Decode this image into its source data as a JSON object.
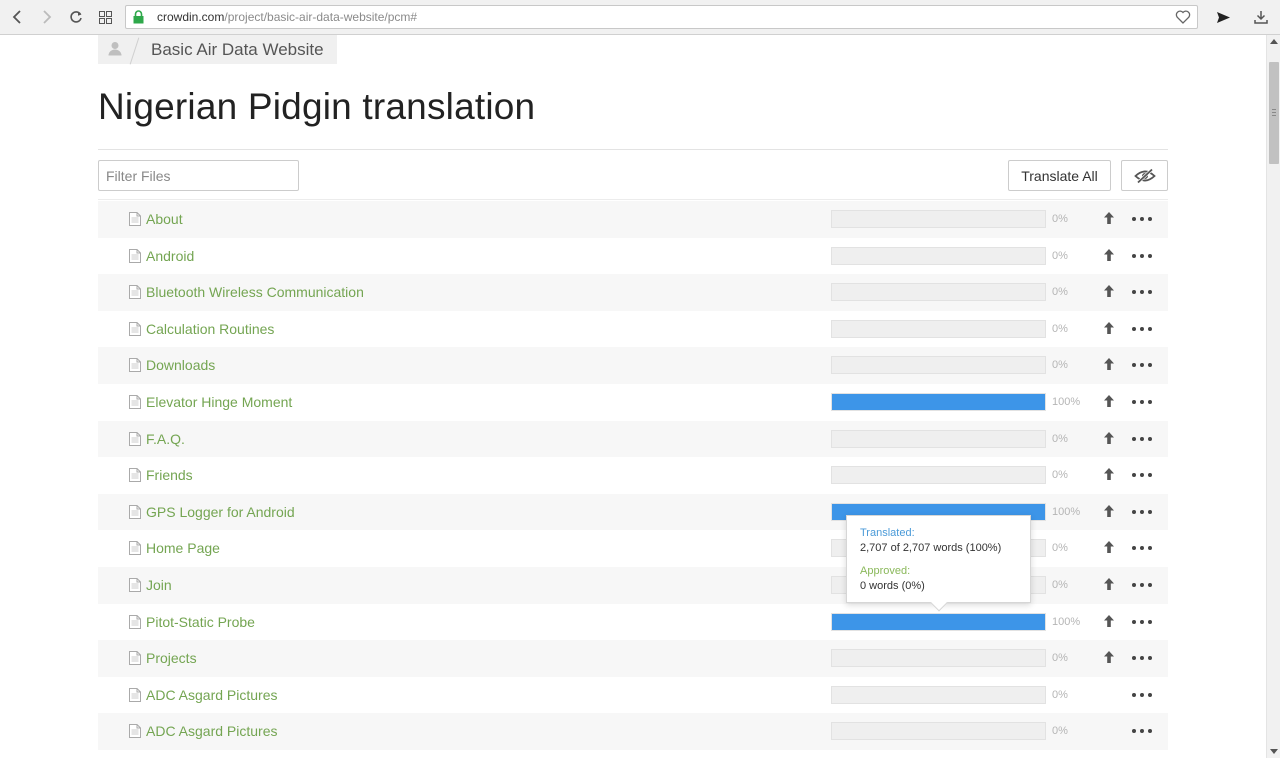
{
  "browser": {
    "url_host": "crowdin.com",
    "url_path": "/project/basic-air-data-website/pcm#"
  },
  "breadcrumb": {
    "project": "Basic Air Data Website"
  },
  "page": {
    "title": "Nigerian Pidgin translation"
  },
  "toolbar": {
    "filter_placeholder": "Filter Files",
    "translate_all_label": "Translate All"
  },
  "files": [
    {
      "name": "About",
      "progress": 0,
      "percent_label": "0%",
      "upload": true
    },
    {
      "name": "Android",
      "progress": 0,
      "percent_label": "0%",
      "upload": true
    },
    {
      "name": "Bluetooth Wireless Communication",
      "progress": 0,
      "percent_label": "0%",
      "upload": true
    },
    {
      "name": "Calculation Routines",
      "progress": 0,
      "percent_label": "0%",
      "upload": true
    },
    {
      "name": "Downloads",
      "progress": 0,
      "percent_label": "0%",
      "upload": true
    },
    {
      "name": "Elevator Hinge Moment",
      "progress": 100,
      "percent_label": "100%",
      "upload": true
    },
    {
      "name": "F.A.Q.",
      "progress": 0,
      "percent_label": "0%",
      "upload": true
    },
    {
      "name": "Friends",
      "progress": 0,
      "percent_label": "0%",
      "upload": true
    },
    {
      "name": "GPS Logger for Android",
      "progress": 100,
      "percent_label": "100%",
      "upload": true
    },
    {
      "name": "Home Page",
      "progress": 0,
      "percent_label": "0%",
      "upload": true
    },
    {
      "name": "Join",
      "progress": 0,
      "percent_label": "0%",
      "upload": true
    },
    {
      "name": "Pitot-Static Probe",
      "progress": 100,
      "percent_label": "100%",
      "upload": true
    },
    {
      "name": "Projects",
      "progress": 0,
      "percent_label": "0%",
      "upload": true
    },
    {
      "name": "ADC Asgard Pictures",
      "progress": 0,
      "percent_label": "0%",
      "upload": false
    },
    {
      "name": "ADC Asgard Pictures",
      "progress": 0,
      "percent_label": "0%",
      "upload": false
    }
  ],
  "tooltip": {
    "translated_label": "Translated:",
    "translated_value": "2,707 of 2,707 words (100%)",
    "approved_label": "Approved:",
    "approved_value": "0 words (0%)"
  },
  "colors": {
    "progress_fill": "#3d95e8",
    "file_link": "#74a552",
    "translated_label": "#4a9ad8",
    "approved_label": "#8ab85a"
  }
}
